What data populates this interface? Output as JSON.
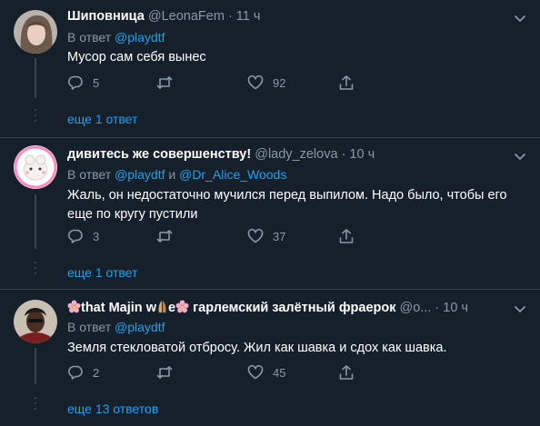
{
  "tweets": [
    {
      "name": "Шиповница",
      "handle": "@LeonaFem",
      "time": "· 11 ч",
      "reply_prefix": "В ответ",
      "mention1": "@playdtf",
      "mention_joiner": "",
      "mention2": "",
      "text": "Мусор сам себя вынес",
      "replies": "5",
      "retweets": "",
      "likes": "92",
      "more_replies": "еще 1 ответ"
    },
    {
      "name": "дивитесь же совершенству!",
      "handle": "@lady_zelova",
      "time": "· 10 ч",
      "reply_prefix": "В ответ",
      "mention1": "@playdtf",
      "mention_joiner": "и",
      "mention2": "@Dr_Alice_Woods",
      "text": "Жаль, он недостаточно мучился перед выпилом. Надо было, чтобы его еще по кругу пустили",
      "replies": "3",
      "retweets": "",
      "likes": "37",
      "more_replies": "еще 1 ответ"
    },
    {
      "name_part1": "that Majin w",
      "name_part2": "e",
      "name_part3": "гарлемский залётный фраерок",
      "handle": "@o...",
      "time": "· 10 ч",
      "reply_prefix": "В ответ",
      "mention1": "@playdtf",
      "mention_joiner": "",
      "mention2": "",
      "text": "Земля стекловатой отбросу. Жил как шавка и сдох как шавка.",
      "replies": "2",
      "retweets": "",
      "likes": "45",
      "more_replies": "еще 13 ответов"
    }
  ],
  "icons": {
    "reply": "reply-icon",
    "retweet": "retweet-icon",
    "like": "heart-icon",
    "share": "share-icon",
    "menu": "chevron-down-icon"
  },
  "colors": {
    "background": "#15202b",
    "link": "#1da1f2",
    "muted": "#8899a6",
    "separator": "#38444d"
  }
}
